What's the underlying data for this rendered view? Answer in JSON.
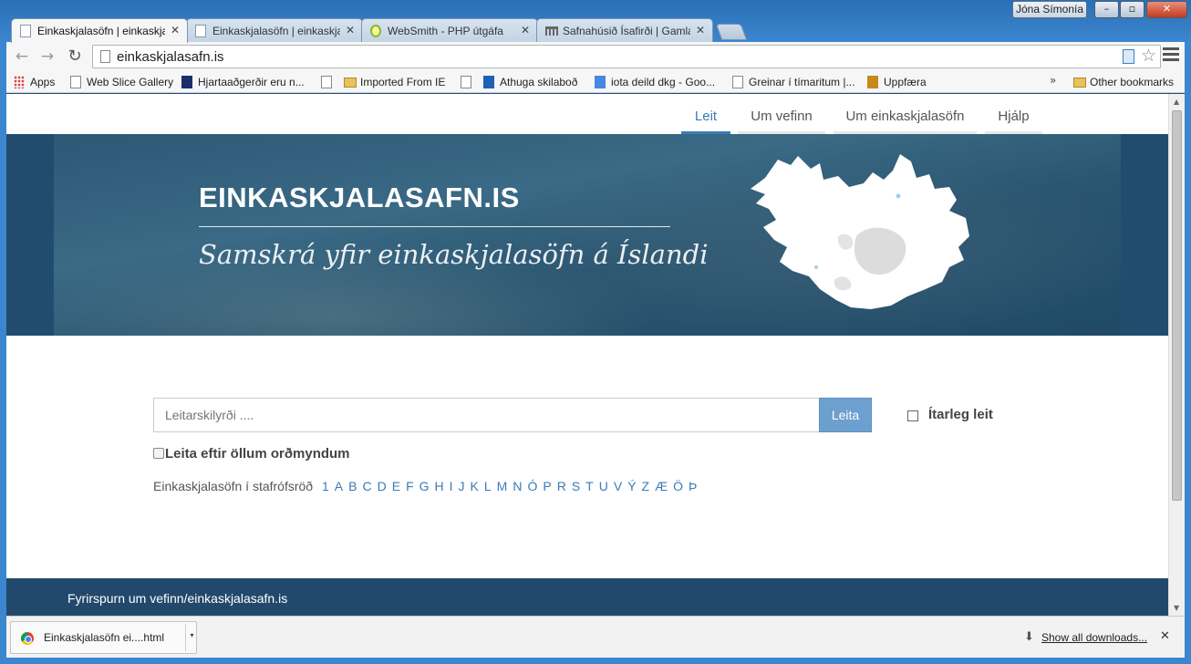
{
  "window": {
    "user": "Jóna Símonía",
    "minimize": "–",
    "maximize": "▫",
    "close": "✕"
  },
  "tabs": [
    {
      "title": "Einkaskjalasöfn | einkaskjalasafn.is",
      "active": true,
      "icon": "page-icon"
    },
    {
      "title": "Einkaskjalasöfn | einkaskjalasafn.is",
      "active": false,
      "icon": "page-icon"
    },
    {
      "title": "WebSmith - PHP útgáfa",
      "active": false,
      "icon": "websmith-icon"
    },
    {
      "title": "Safnahúsið Ísafirði | Gamla sjúkrahúsið",
      "active": false,
      "icon": "building-icon"
    }
  ],
  "tab_close": "✕",
  "toolbar": {
    "back": "←",
    "forward": "→",
    "reload": "↻",
    "url": "einkaskjalasafn.is"
  },
  "bookmarks": {
    "items": [
      "Apps",
      "Web Slice Gallery",
      "Hjartaaðgerðir eru n...",
      "",
      "Imported From IE",
      "",
      "Athuga skilaboð",
      "iota deild dkg - Goo...",
      "Greinar í tímaritum |...",
      "Uppfæra"
    ],
    "more": "»",
    "other": "Other bookmarks"
  },
  "site": {
    "nav": [
      "Leit",
      "Um vefinn",
      "Um einkaskjalasöfn",
      "Hjálp"
    ],
    "hero_title": "EINKASKJALASAFN.IS",
    "hero_subtitle": "Samskrá yfir einkaskjalasöfn á Íslandi",
    "search_placeholder": "Leitarskilyrði ....",
    "search_button": "Leita",
    "advanced_label": "Ítarleg leit",
    "all_forms_label": "Leita eftir öllum orðmyndum",
    "alpha_label": "Einkaskjalasöfn í stafrófsröð",
    "alpha_letters": [
      "1",
      "A",
      "B",
      "C",
      "D",
      "E",
      "F",
      "G",
      "H",
      "I",
      "J",
      "K",
      "L",
      "M",
      "N",
      "Ó",
      "P",
      "R",
      "S",
      "T",
      "U",
      "V",
      "Ý",
      "Z",
      "Æ",
      "Ö",
      "Þ"
    ],
    "footer_link": "Fyrirspurn um vefinn/einkaskjalasafn.is"
  },
  "downloads": {
    "file_name": "Einkaskjalasöfn   ei....html",
    "show_all": "Show all downloads...",
    "close": "✕"
  },
  "colors": {
    "accent": "#3b7bb8",
    "hero": "#224c6e",
    "footer": "#22496c",
    "search_button": "#6d9fcf"
  }
}
